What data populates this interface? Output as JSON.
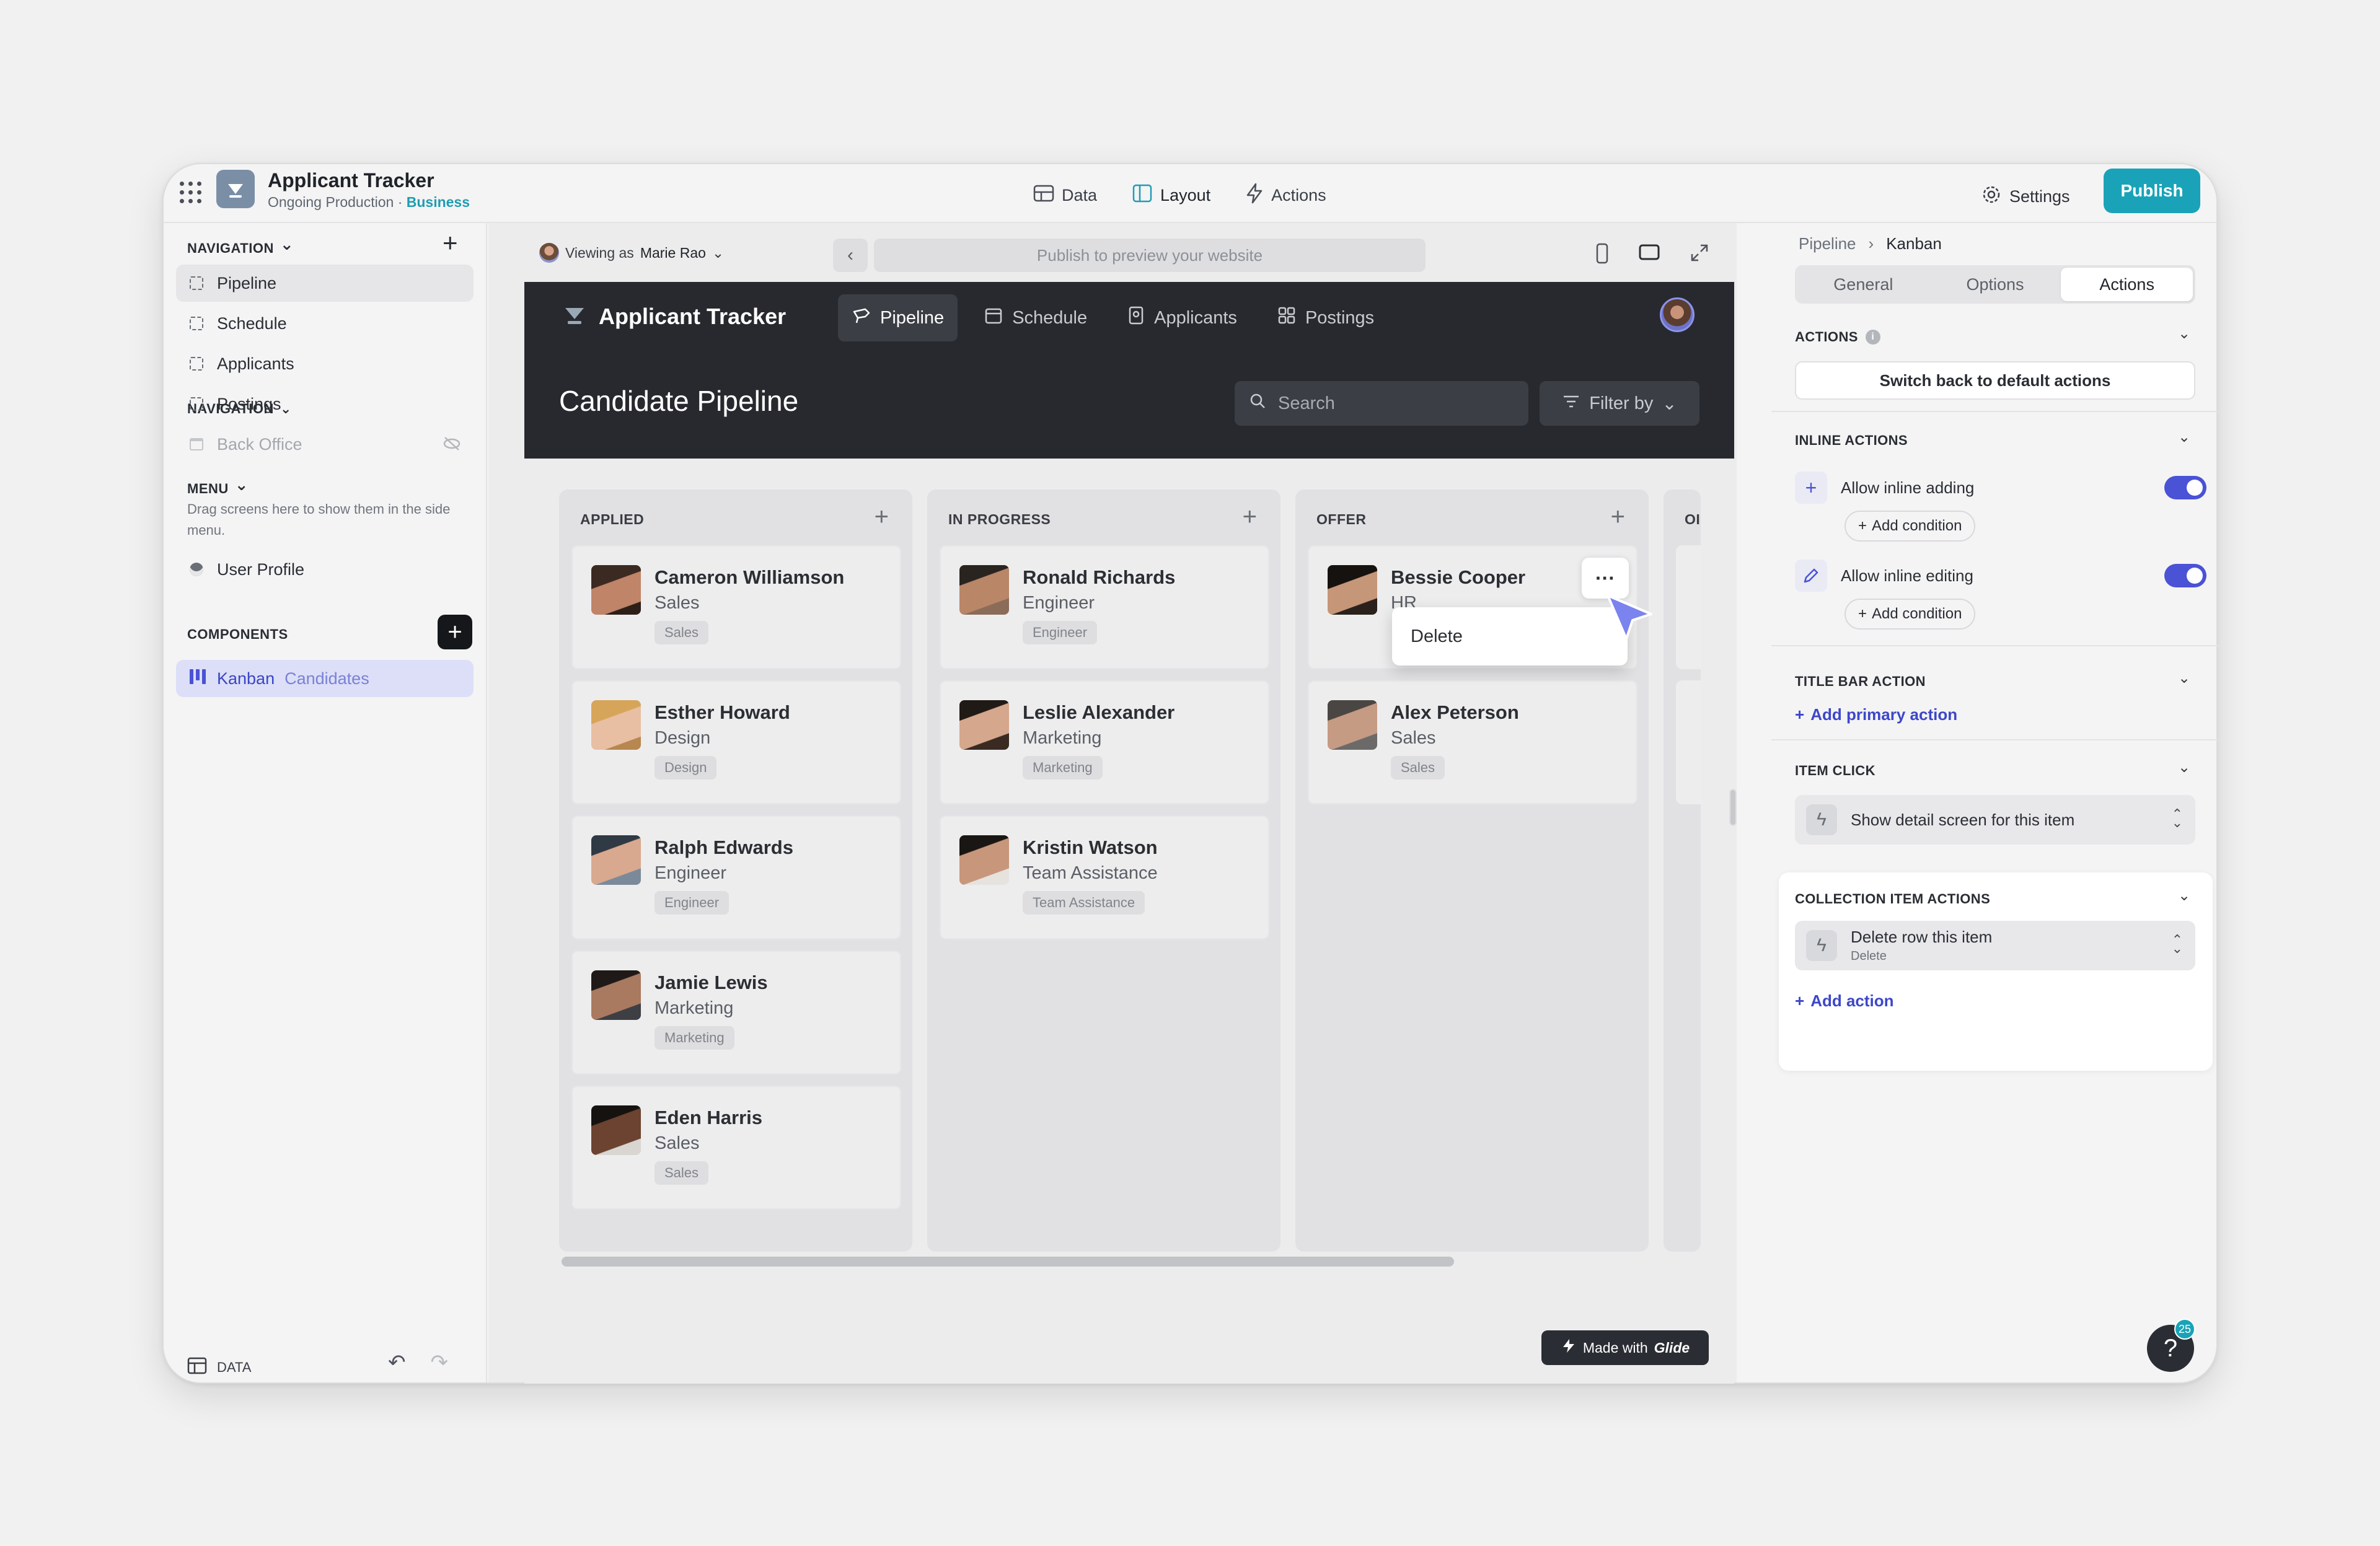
{
  "app": {
    "title": "Applicant Tracker",
    "subtitle": "Ongoing Production · ",
    "plan": "Business",
    "nav": [
      {
        "label": "Data",
        "icon": "table-icon"
      },
      {
        "label": "Layout",
        "icon": "layout-icon"
      },
      {
        "label": "Actions",
        "icon": "bolt-icon"
      }
    ],
    "settings_label": "Settings",
    "publish_label": "Publish"
  },
  "left": {
    "navigation_heading": "NAVIGATION",
    "nav_items": [
      "Pipeline",
      "Schedule",
      "Applicants",
      "Postings",
      "Back Office"
    ],
    "menu_heading": "MENU",
    "menu_hint": "Drag screens here to show them in the side menu.",
    "user_profile": "User Profile",
    "components_heading": "COMPONENTS",
    "component_kind": "Kanban",
    "component_source": "Candidates",
    "data_label": "DATA"
  },
  "preview": {
    "viewing_prefix": "Viewing as",
    "viewing_user": "Marie Rao",
    "url_placeholder": "Publish to preview your website",
    "app_title": "Applicant Tracker",
    "tabs": [
      "Pipeline",
      "Schedule",
      "Applicants",
      "Postings"
    ],
    "page_title": "Candidate Pipeline",
    "search_placeholder": "Search",
    "filter_label": "Filter by",
    "made_with": "Made with",
    "made_with_brand": "Glide",
    "context_menu_item": "Delete",
    "columns": [
      {
        "title": "APPLIED",
        "cards": [
          {
            "name": "Cameron Williamson",
            "role": "Sales",
            "tag": "Sales"
          },
          {
            "name": "Esther Howard",
            "role": "Design",
            "tag": "Design"
          },
          {
            "name": "Ralph Edwards",
            "role": "Engineer",
            "tag": "Engineer"
          },
          {
            "name": "Jamie Lewis",
            "role": "Marketing",
            "tag": "Marketing"
          },
          {
            "name": "Eden Harris",
            "role": "Sales",
            "tag": "Sales"
          }
        ]
      },
      {
        "title": "IN PROGRESS",
        "cards": [
          {
            "name": "Ronald Richards",
            "role": "Engineer",
            "tag": "Engineer"
          },
          {
            "name": "Leslie Alexander",
            "role": "Marketing",
            "tag": "Marketing"
          },
          {
            "name": "Kristin Watson",
            "role": "Team Assistance",
            "tag": "Team Assistance"
          }
        ]
      },
      {
        "title": "OFFER",
        "cards": [
          {
            "name": "Bessie Cooper",
            "role": "HR",
            "tag": "HR"
          },
          {
            "name": "Alex Peterson",
            "role": "Sales",
            "tag": "Sales"
          }
        ]
      },
      {
        "title": "OI",
        "cards": []
      }
    ]
  },
  "right": {
    "breadcrumb": [
      "Pipeline",
      "Kanban"
    ],
    "tabs": [
      "General",
      "Options",
      "Actions"
    ],
    "actions_heading": "ACTIONS",
    "switch_default": "Switch back to default actions",
    "inline_heading": "INLINE ACTIONS",
    "allow_adding": "Allow inline adding",
    "allow_editing": "Allow inline editing",
    "add_condition": "Add condition",
    "title_bar_heading": "TITLE BAR ACTION",
    "add_primary": "Add primary action",
    "item_click_heading": "ITEM CLICK",
    "item_click_value": "Show detail screen for this item",
    "collection_heading": "COLLECTION ITEM ACTIONS",
    "collection_action_title": "Delete row this item",
    "collection_action_sub": "Delete",
    "add_action": "Add action",
    "help_badge": "25"
  }
}
